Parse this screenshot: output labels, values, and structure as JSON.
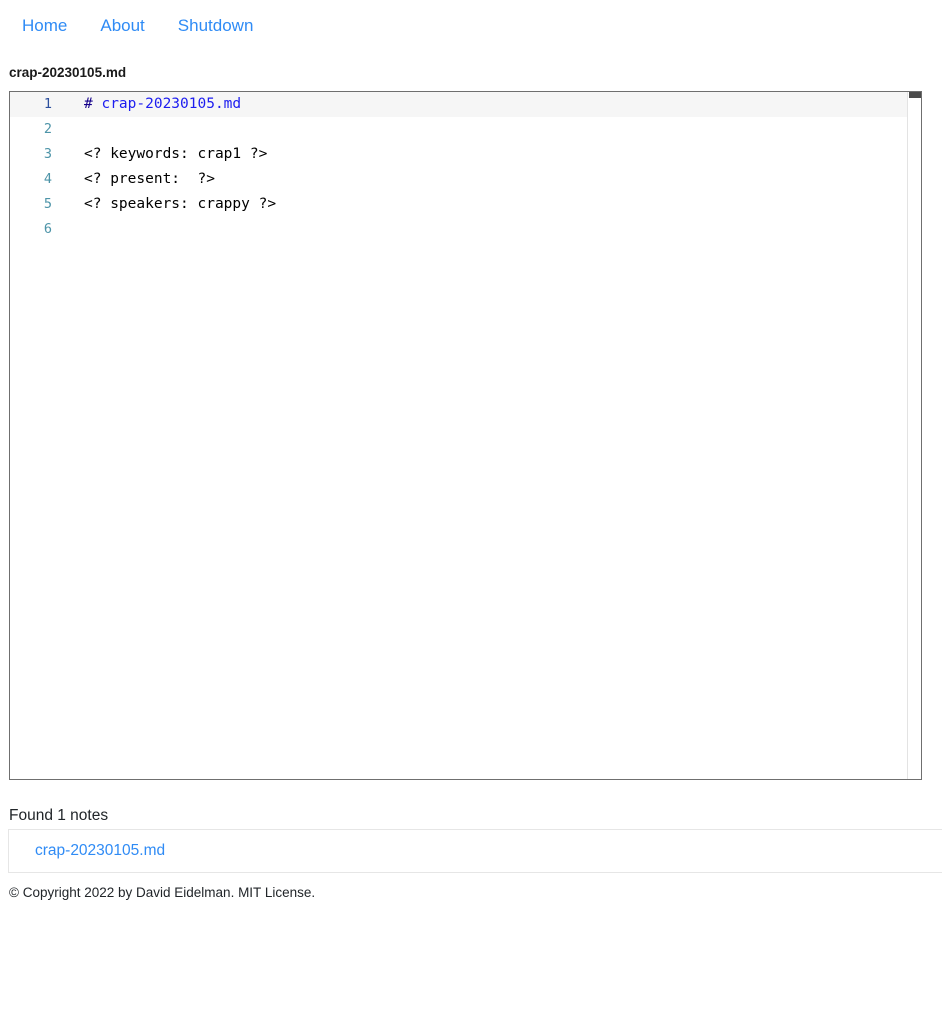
{
  "nav": {
    "links": [
      {
        "label": "Home",
        "name": "nav-link-home"
      },
      {
        "label": "About",
        "name": "nav-link-about"
      },
      {
        "label": "Shutdown",
        "name": "nav-link-shutdown"
      }
    ]
  },
  "page": {
    "title": "crap-20230105.md"
  },
  "editor": {
    "lines": [
      {
        "number": "1",
        "active": true,
        "segments": [
          {
            "text": "# ",
            "class": "tok-hash"
          },
          {
            "text": "crap-20230105.md",
            "class": "tok-head"
          }
        ]
      },
      {
        "number": "2",
        "active": false,
        "segments": [
          {
            "text": "",
            "class": ""
          }
        ]
      },
      {
        "number": "3",
        "active": false,
        "segments": [
          {
            "text": "<? keywords: crap1 ?>",
            "class": ""
          }
        ]
      },
      {
        "number": "4",
        "active": false,
        "segments": [
          {
            "text": "<? present:  ?>",
            "class": ""
          }
        ]
      },
      {
        "number": "5",
        "active": false,
        "segments": [
          {
            "text": "<? speakers: crappy ?>",
            "class": ""
          }
        ]
      },
      {
        "number": "6",
        "active": false,
        "segments": [
          {
            "text": "",
            "class": ""
          }
        ]
      }
    ]
  },
  "results": {
    "heading": "Found 1 notes",
    "notes": [
      {
        "label": "crap-20230105.md"
      }
    ]
  },
  "footer": {
    "copyright": "© Copyright 2022 by David Eidelman. MIT License."
  },
  "colors": {
    "link": "#2f8bf5",
    "gutter": "#4d94a8",
    "heading_token": "#1d1df0",
    "hash_token": "#14008a",
    "editor_border": "#6f6f6f",
    "scrollbar_thumb": "#4b4b4b"
  }
}
